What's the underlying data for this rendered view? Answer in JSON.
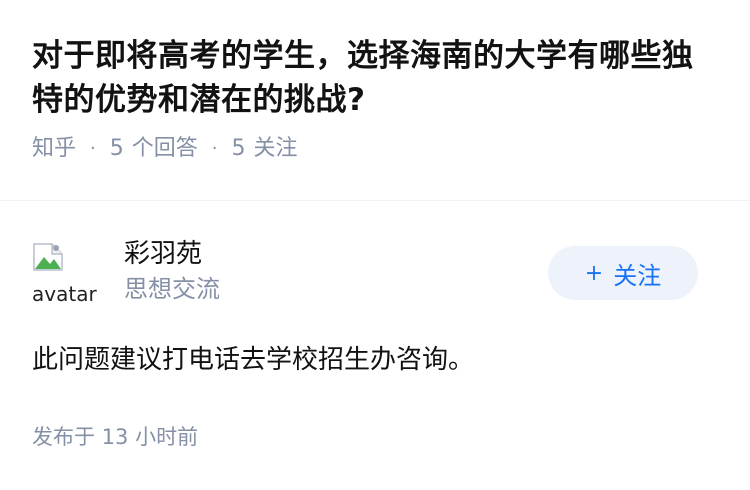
{
  "question": {
    "title": "对于即将高考的学生，选择海南的大学有哪些独特的优势和潜在的挑战?",
    "source": "知乎",
    "answer_count": "5",
    "answer_label": "个回答",
    "follower_count": "5",
    "follower_label": "关注",
    "separator": "·"
  },
  "answer": {
    "author": {
      "avatar_alt": "avatar",
      "name": "彩羽苑",
      "description": "思想交流"
    },
    "follow_button": {
      "plus": "+",
      "label": "关注"
    },
    "content": "此问题建议打电话去学校招生办咨询。",
    "published_time": "发布于 13 小时前"
  },
  "colors": {
    "title": "#121212",
    "meta": "#8590a6",
    "accent": "#1772f6",
    "follow_bg": "#eef3fb"
  }
}
